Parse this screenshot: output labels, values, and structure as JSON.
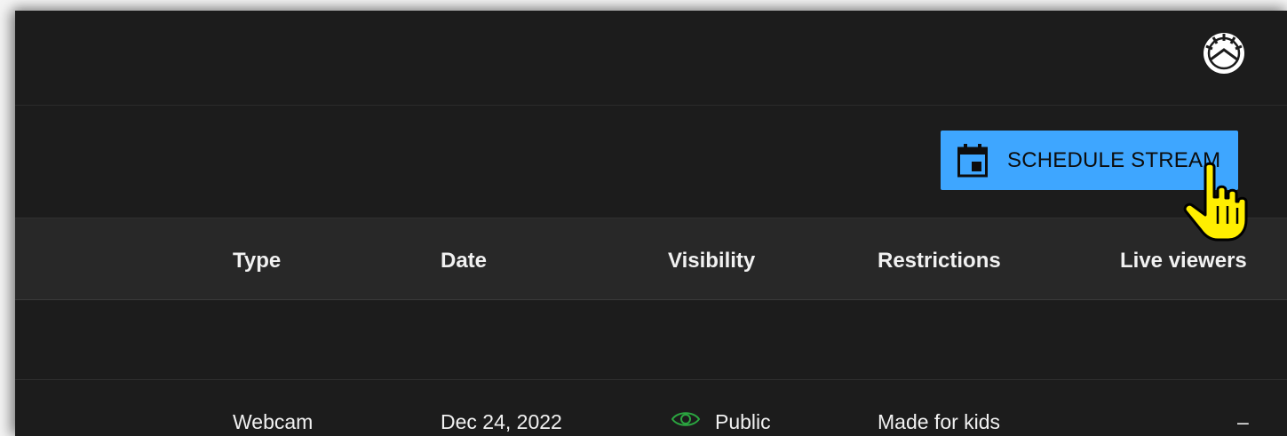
{
  "header": {
    "avatar_icon": "channel-avatar-icon"
  },
  "toolbar": {
    "schedule_label": "SCHEDULE STREAM",
    "schedule_icon": "calendar-icon",
    "button_color": "#3ea6ff"
  },
  "table": {
    "columns": [
      "Type",
      "Date",
      "Visibility",
      "Restrictions",
      "Live viewers"
    ],
    "rows": [
      {
        "type": "Webcam",
        "date": "Dec 24, 2022",
        "visibility": "Public",
        "visibility_icon": "eye-icon",
        "visibility_color": "#2ba640",
        "restrictions": "Made for kids",
        "live_viewers": "–"
      }
    ]
  },
  "cursor": {
    "icon": "hand-pointer-icon",
    "color": "#ffee00"
  }
}
